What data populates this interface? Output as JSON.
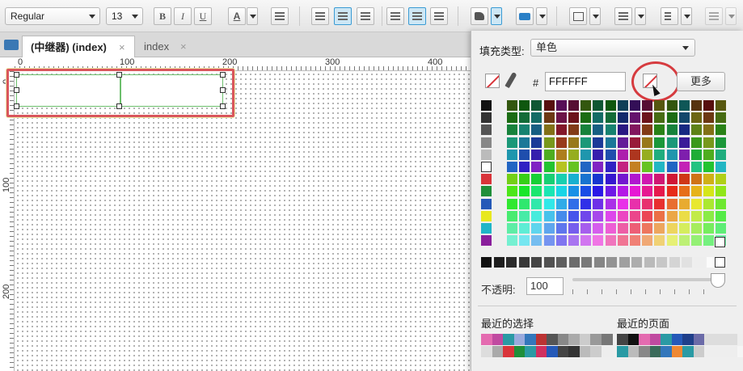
{
  "toolbar": {
    "font_style": "Regular",
    "font_size": "13",
    "bold": "B",
    "italic": "I",
    "underline": "U",
    "font_color": "A"
  },
  "tabs": [
    {
      "label": "(中继器) (index)",
      "active": true
    },
    {
      "label": "index",
      "active": false
    }
  ],
  "close_glyph": "×",
  "ruler": {
    "top_labels": [
      "0",
      "100",
      "200",
      "300",
      "400"
    ],
    "left_labels": [
      "0",
      "100",
      "200"
    ]
  },
  "fill_panel": {
    "fill_type_label": "填充类型:",
    "fill_type_value": "单色",
    "hash_label": "#",
    "hex_value": "FFFFFF",
    "more_button": "更多",
    "opacity_label": "不透明:",
    "opacity_value": "100",
    "recent_selection_label": "最近的选择",
    "recent_page_label": "最近的页面"
  },
  "colors": {
    "accent": "#3a9bd4",
    "highlight_red": "#d63b3f",
    "widget_border": "#6cbf6c"
  }
}
